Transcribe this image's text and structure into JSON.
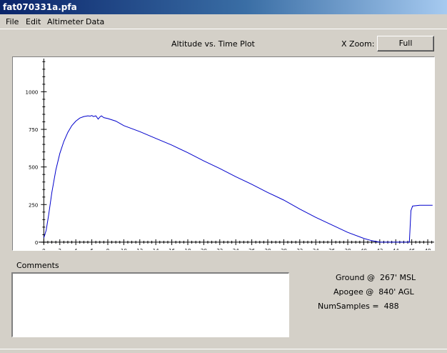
{
  "window": {
    "title": "fat070331a.pfa"
  },
  "menu": {
    "items": [
      "File",
      "Edit",
      "Altimeter",
      "Data"
    ]
  },
  "plot_header": {
    "title": "Altitude vs. Time Plot",
    "xzoom_label": "X Zoom:",
    "full_label": "Full"
  },
  "comments": {
    "label": "Comments",
    "value": ""
  },
  "stats": {
    "ground": "Ground @  267' MSL",
    "apogee": "Apogee @  840' AGL",
    "samples": "NumSamples =  488"
  },
  "colors": {
    "trace": "#0000cc",
    "window_bg": "#d4d0c8",
    "plot_bg": "#ffffff"
  },
  "chart_data": {
    "type": "line",
    "title": "Altitude vs. Time Plot",
    "xlabel": "",
    "ylabel": "",
    "xlim": [
      -0.3,
      48.8
    ],
    "ylim": [
      -10,
      1230
    ],
    "x_ticks": [
      0,
      2,
      4,
      6,
      8,
      10,
      12,
      14,
      16,
      18,
      20,
      22,
      24,
      26,
      28,
      30,
      32,
      34,
      36,
      38,
      40,
      42,
      44,
      46,
      48
    ],
    "y_ticks": [
      0,
      250,
      500,
      750,
      1000
    ],
    "grid": false,
    "series": [
      {
        "values_x": [
          0,
          0.3,
          0.6,
          1,
          1.5,
          2,
          2.5,
          3,
          3.5,
          4,
          4.5,
          5,
          5.5,
          5.8,
          6,
          6.2,
          6.5,
          6.8,
          7,
          7.2,
          7.5,
          8,
          9,
          10,
          12,
          14,
          16,
          18,
          20,
          22,
          24,
          26,
          28,
          30,
          32,
          34,
          36,
          38,
          40,
          41,
          42,
          43,
          44,
          45,
          45.7,
          45.9,
          46.1,
          47,
          48,
          48.6
        ],
        "values_y": [
          30,
          80,
          180,
          330,
          480,
          590,
          670,
          730,
          775,
          805,
          825,
          835,
          840,
          838,
          842,
          835,
          840,
          818,
          832,
          840,
          828,
          822,
          805,
          775,
          735,
          690,
          645,
          595,
          540,
          490,
          435,
          385,
          330,
          280,
          220,
          165,
          115,
          65,
          25,
          10,
          0,
          0,
          0,
          0,
          0,
          210,
          240,
          245,
          245,
          245
        ]
      }
    ]
  }
}
